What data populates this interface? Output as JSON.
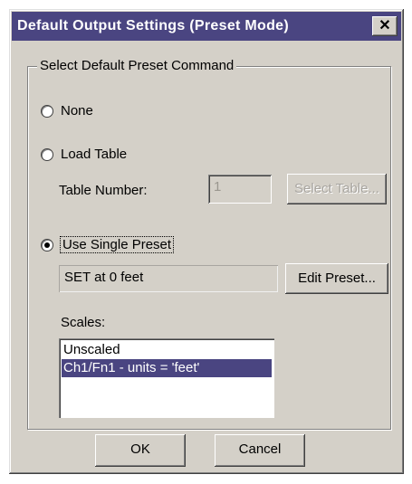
{
  "dialog": {
    "title": "Default Output Settings (Preset Mode)",
    "close_glyph": "✕"
  },
  "group": {
    "legend": "Select Default Preset Command"
  },
  "options": {
    "none": {
      "label": "None",
      "checked": false
    },
    "load_table": {
      "label": "Load Table",
      "checked": false
    },
    "use_single_preset": {
      "label": "Use Single Preset",
      "checked": true
    }
  },
  "table": {
    "number_label": "Table Number:",
    "number_value": "1",
    "select_button": "Select Table..."
  },
  "preset": {
    "value": "SET at 0 feet",
    "edit_button": "Edit Preset..."
  },
  "scales": {
    "label": "Scales:",
    "items": [
      "Unscaled",
      "Ch1/Fn1 - units = 'feet'"
    ],
    "selected_index": 1
  },
  "buttons": {
    "ok": "OK",
    "cancel": "Cancel"
  },
  "colors": {
    "title_bar": "#4a4581",
    "face": "#d4d0c8",
    "selection": "#4a4581"
  }
}
